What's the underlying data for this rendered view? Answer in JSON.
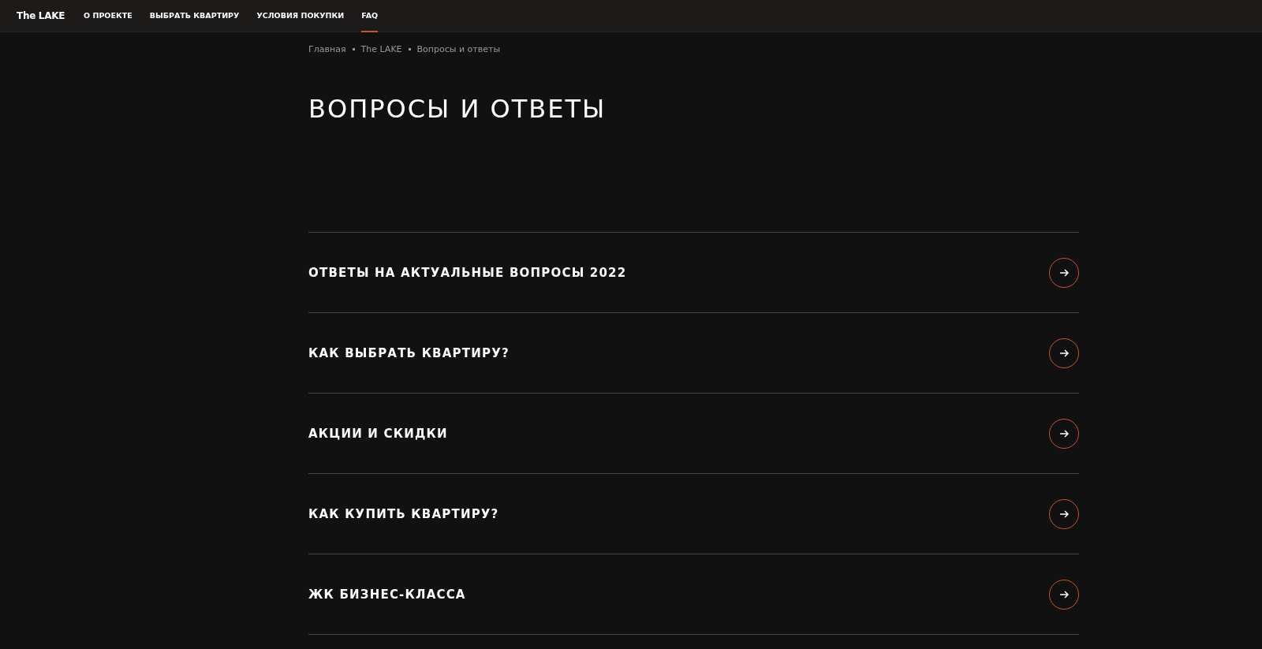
{
  "header": {
    "logo": "The LAKE",
    "nav": [
      {
        "label": "О ПРОЕКТЕ",
        "selected": false
      },
      {
        "label": "ВЫБРАТЬ КВАРТИРУ",
        "selected": false
      },
      {
        "label": "УСЛОВИЯ ПОКУПКИ",
        "selected": false
      },
      {
        "label": "FAQ",
        "selected": true
      }
    ]
  },
  "breadcrumbs": [
    "Главная",
    "The LAKE",
    "Вопросы и ответы"
  ],
  "title": "ВОПРОСЫ И ОТВЕТЫ",
  "faq": [
    {
      "label": "ОТВЕТЫ НА АКТУАЛЬНЫЕ ВОПРОСЫ 2022"
    },
    {
      "label": "КАК ВЫБРАТЬ КВАРТИРУ?"
    },
    {
      "label": "АКЦИИ И СКИДКИ"
    },
    {
      "label": "КАК КУПИТЬ КВАРТИРУ?"
    },
    {
      "label": "ЖК БИЗНЕС-КЛАССА"
    }
  ]
}
